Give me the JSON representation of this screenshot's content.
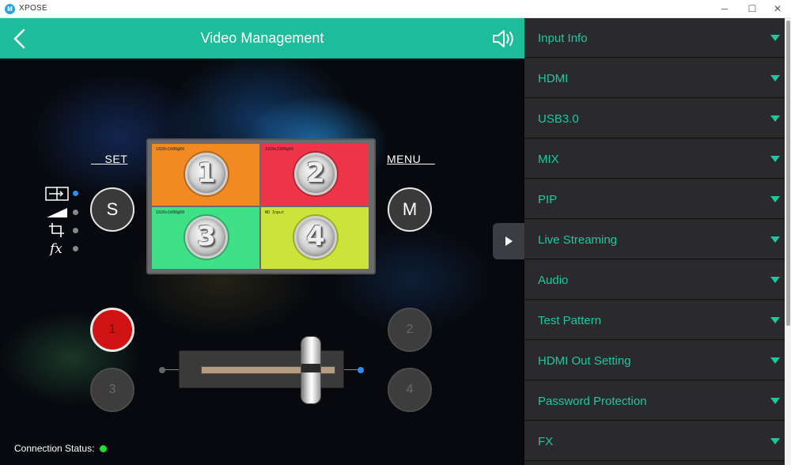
{
  "window": {
    "logo": "M",
    "title": "XPOSE",
    "minimize_glyph": "─",
    "maximize_glyph": "☐",
    "close_glyph": "✕"
  },
  "header": {
    "title": "Video Management",
    "back_icon": "chevron-left-icon",
    "sound_icon": "speaker-icon"
  },
  "controls": {
    "set_label": "    SET",
    "menu_label": "MENU    ",
    "s_button": "S",
    "m_button": "M",
    "modes": [
      {
        "icon": "layout-switch-icon",
        "active": true
      },
      {
        "icon": "fade-ramp-icon",
        "active": false
      },
      {
        "icon": "crop-icon",
        "active": false
      },
      {
        "icon": "fx-icon",
        "active": false
      }
    ]
  },
  "preview": {
    "quads": [
      {
        "resolution": "1920x1080@60",
        "number": "1",
        "color": "#f28a22"
      },
      {
        "resolution": "1920x1080@60",
        "number": "2",
        "color": "#ee3448"
      },
      {
        "resolution": "1920x1080@60",
        "number": "3",
        "color": "#3ee186"
      },
      {
        "resolution": "NO Input",
        "number": "4",
        "color": "#cbe33a"
      }
    ]
  },
  "sources": {
    "buttons": [
      "1",
      "2",
      "3",
      "4"
    ],
    "active": "1"
  },
  "transition": {
    "position": 0.82
  },
  "status": {
    "label": "Connection Status:",
    "color": "#22e030"
  },
  "menu": {
    "accent": "#1dc7a2",
    "items": [
      {
        "label": "Input Info"
      },
      {
        "label": "HDMI"
      },
      {
        "label": "USB3.0"
      },
      {
        "label": "MIX"
      },
      {
        "label": "PIP"
      },
      {
        "label": "Live Streaming"
      },
      {
        "label": "Audio"
      },
      {
        "label": "Test Pattern"
      },
      {
        "label": "HDMI Out Setting"
      },
      {
        "label": "Password Protection"
      },
      {
        "label": "FX"
      }
    ]
  }
}
